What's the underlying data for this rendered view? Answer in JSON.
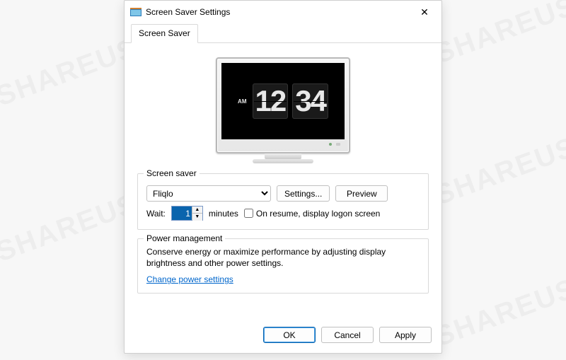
{
  "watermark": "SHAREUS",
  "window": {
    "title": "Screen Saver Settings",
    "close_glyph": "✕"
  },
  "tab": {
    "label": "Screen Saver"
  },
  "preview_clock": {
    "ampm": "AM",
    "hours": "12",
    "minutes": "34"
  },
  "saver_group": {
    "legend": "Screen saver",
    "selected": "Fliqlo",
    "settings_btn": "Settings...",
    "preview_btn": "Preview",
    "wait_label": "Wait:",
    "wait_value": "1",
    "minutes_label": "minutes",
    "on_resume_label": "On resume, display logon screen"
  },
  "power_group": {
    "legend": "Power management",
    "description": "Conserve energy or maximize performance by adjusting display brightness and other power settings.",
    "link": "Change power settings"
  },
  "footer": {
    "ok": "OK",
    "cancel": "Cancel",
    "apply": "Apply"
  }
}
